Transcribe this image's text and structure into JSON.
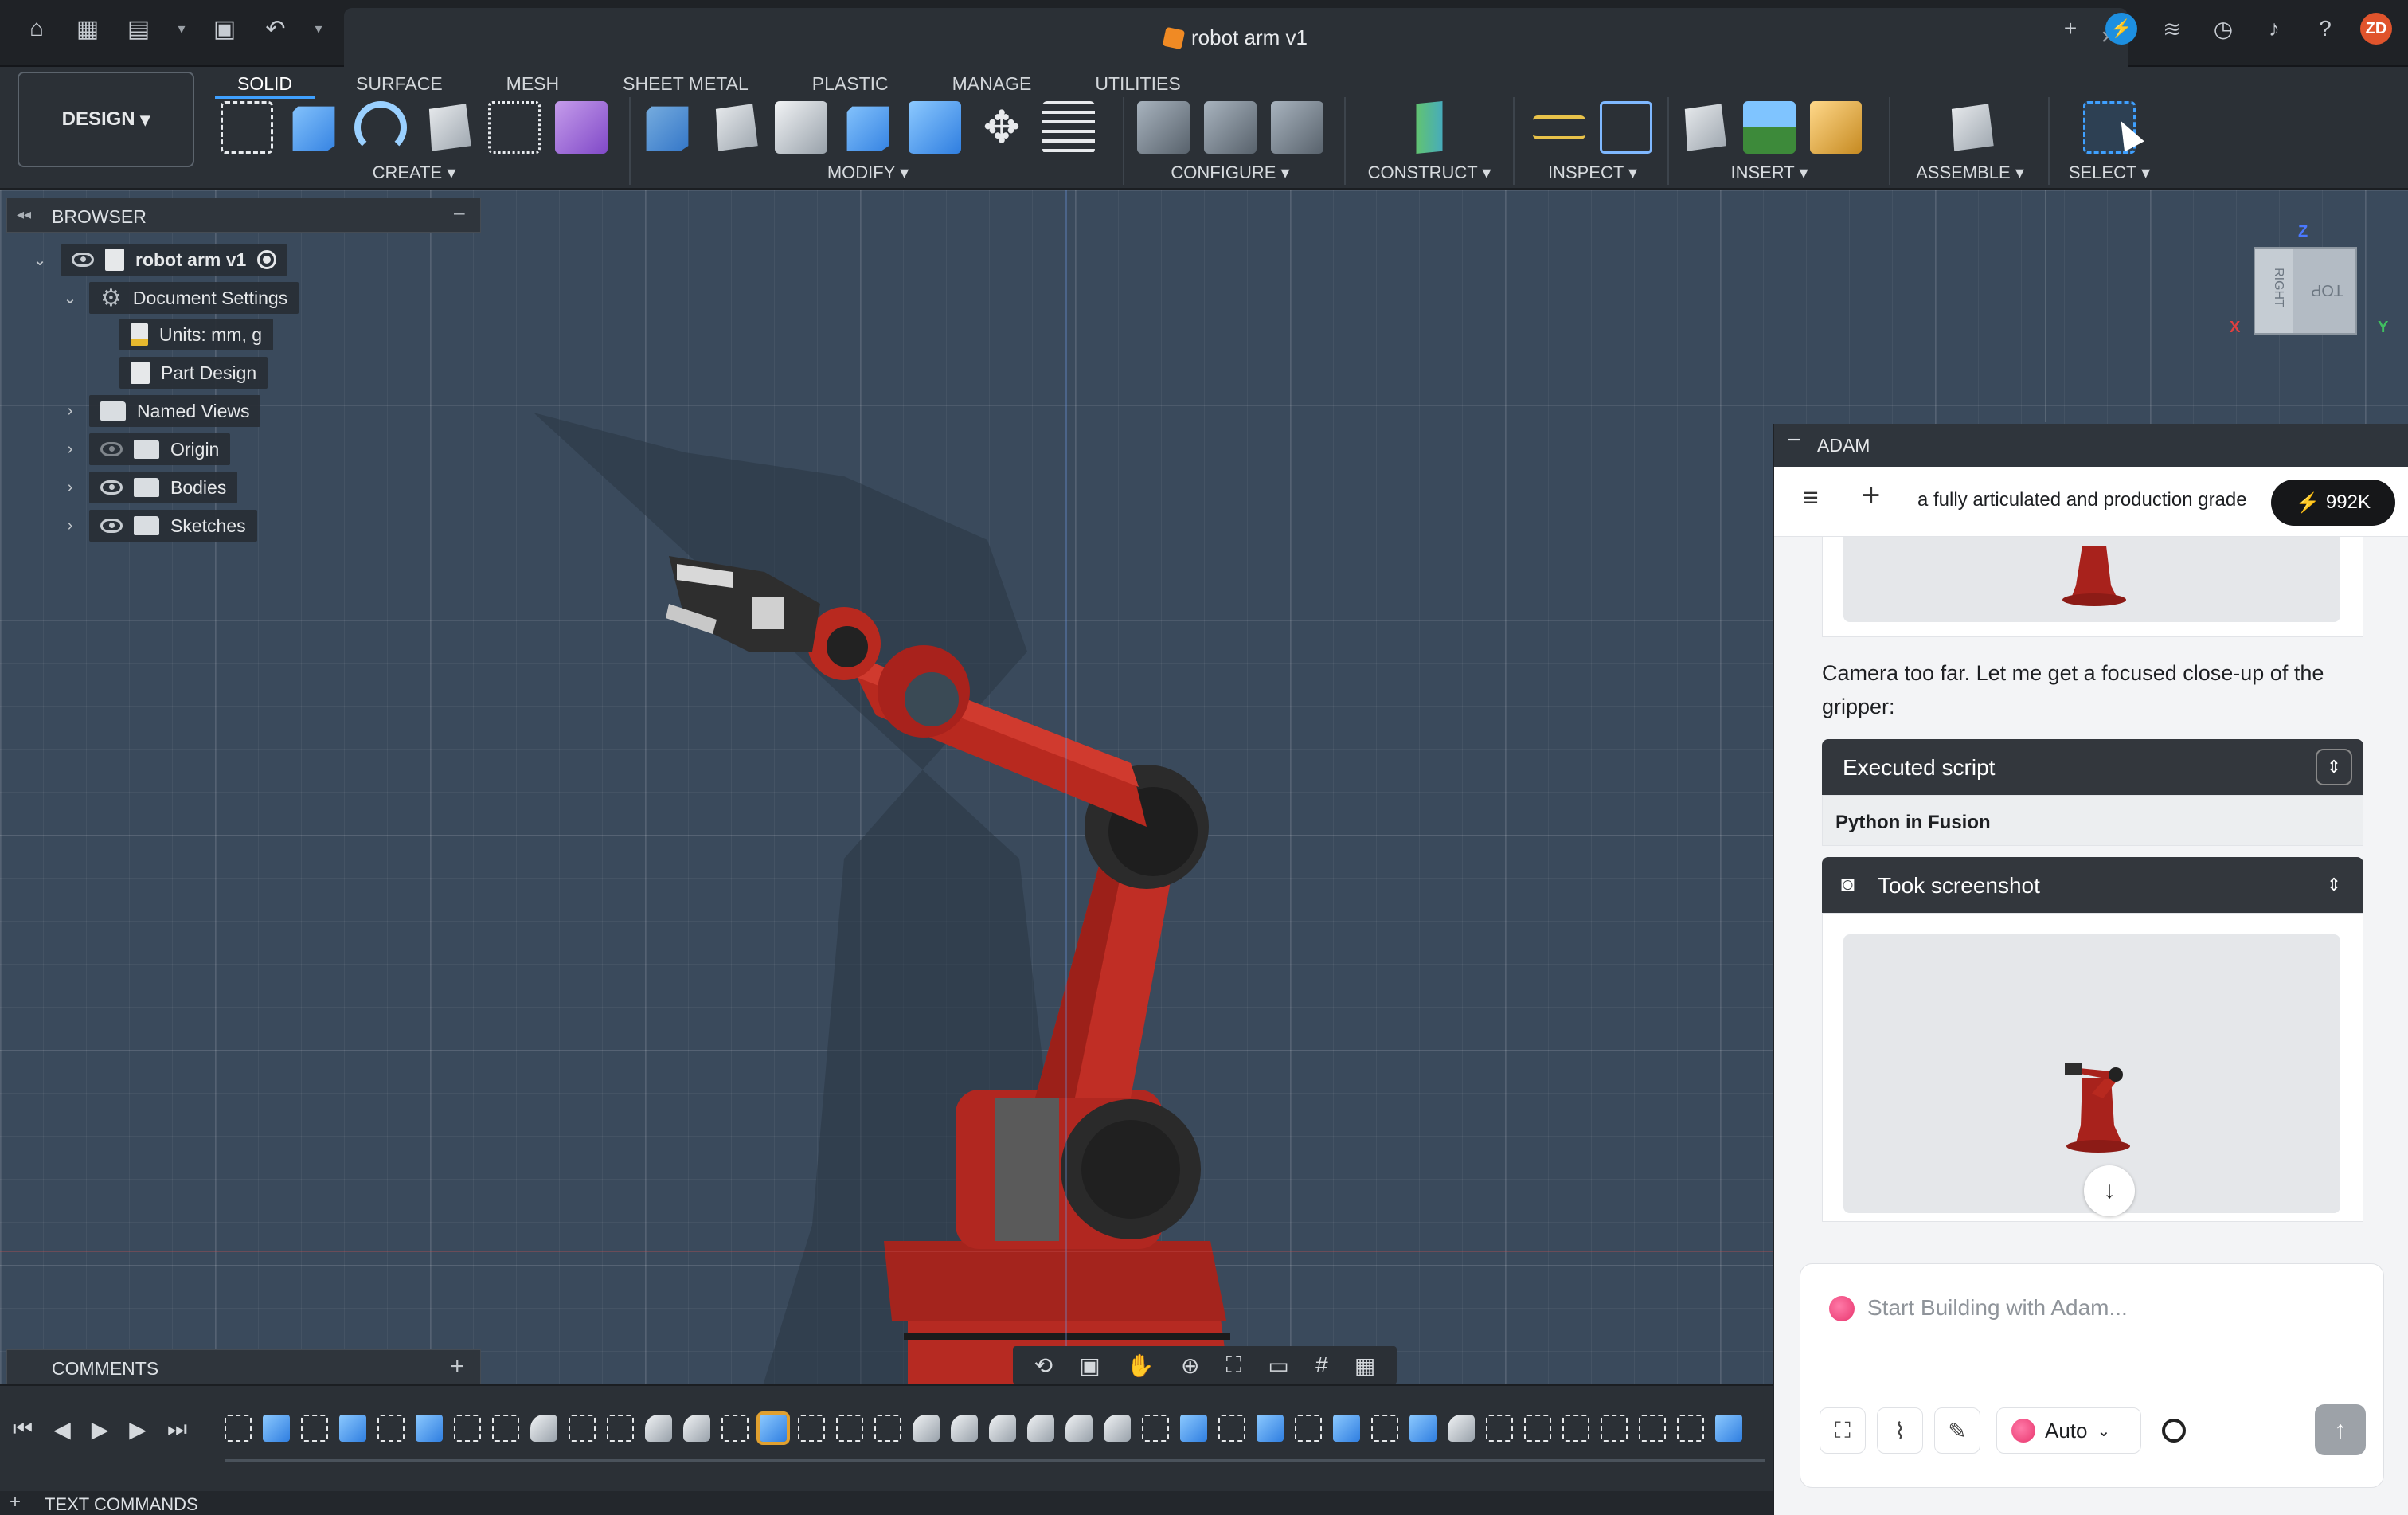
{
  "app": {
    "document_title": "robot arm v1"
  },
  "toolbar": {
    "workspace": "DESIGN",
    "tabs": [
      "SOLID",
      "SURFACE",
      "MESH",
      "SHEET METAL",
      "PLASTIC",
      "MANAGE",
      "UTILITIES"
    ],
    "active_tab": "SOLID",
    "groups": {
      "create": "CREATE",
      "modify": "MODIFY",
      "configure": "CONFIGURE",
      "construct": "CONSTRUCT",
      "inspect": "INSPECT",
      "insert": "INSERT",
      "assemble": "ASSEMBLE",
      "select": "SELECT"
    }
  },
  "browser": {
    "title": "BROWSER",
    "root": "robot arm v1",
    "items": [
      {
        "label": "Document Settings"
      },
      {
        "label": "Units: mm, g"
      },
      {
        "label": "Part Design"
      },
      {
        "label": "Named Views"
      },
      {
        "label": "Origin"
      },
      {
        "label": "Bodies"
      },
      {
        "label": "Sketches"
      }
    ]
  },
  "comments": {
    "title": "COMMENTS"
  },
  "text_commands": {
    "title": "TEXT COMMANDS"
  },
  "viewcube": {
    "right_label": "RIGHT",
    "top_label": "TOP",
    "axes": {
      "x": "X",
      "y": "Y",
      "z": "Z"
    }
  },
  "adam": {
    "panel_title": "ADAM",
    "conversation_title": "a fully articulated and production grade",
    "credits": "992K",
    "message": "Camera too far. Let me get a focused close-up of the gripper:",
    "executed_script": {
      "label": "Executed script",
      "detail": "Python in Fusion"
    },
    "screenshot_tool": {
      "label": "Took screenshot"
    },
    "composer": {
      "placeholder": "Start Building with Adam...",
      "mode": "Auto"
    }
  },
  "colors": {
    "accent": "#3fa0ff",
    "robot_red": "#a8221c",
    "canvas": "#3a4a5c"
  }
}
